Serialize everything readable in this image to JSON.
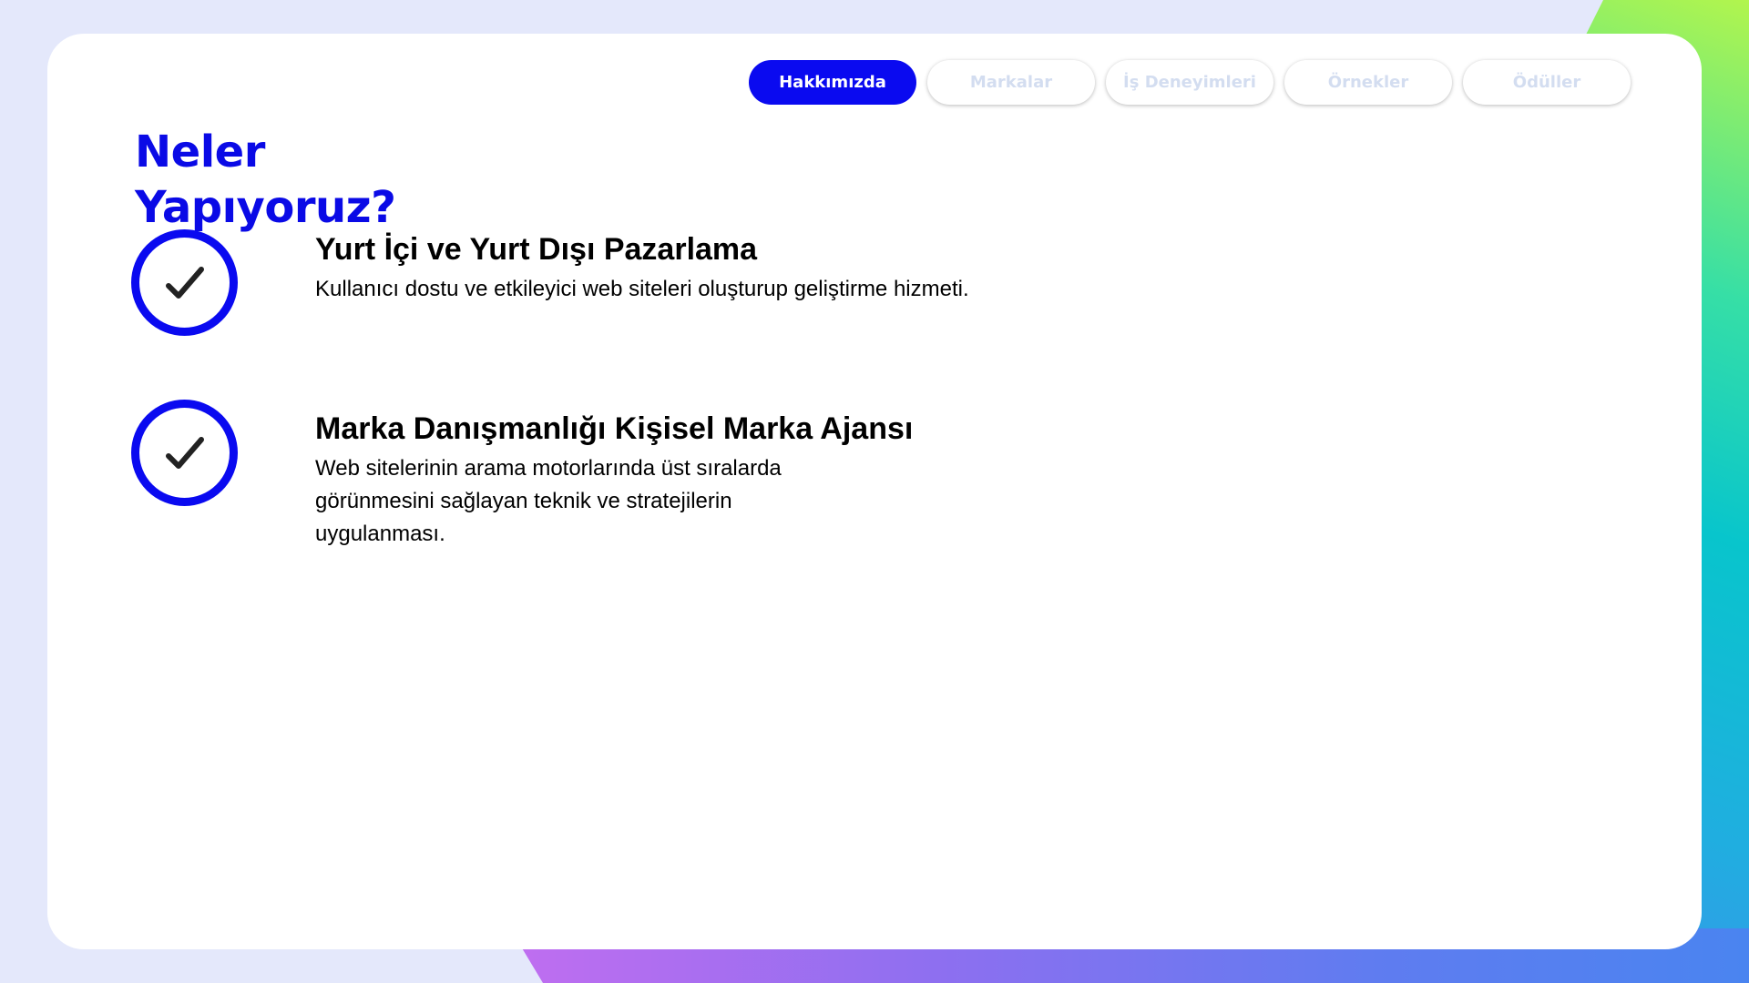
{
  "nav": {
    "tabs": [
      {
        "label": "Hakkımızda",
        "active": true
      },
      {
        "label": "Markalar",
        "active": false
      },
      {
        "label": "İş Deneyimleri",
        "active": false
      },
      {
        "label": "Örnekler",
        "active": false
      },
      {
        "label": "Ödüller",
        "active": false
      }
    ]
  },
  "heading": {
    "line1": "Neler",
    "line2": "Yapıyoruz?"
  },
  "features": [
    {
      "icon": "check-icon",
      "title": "Yurt İçi ve Yurt Dışı Pazarlama",
      "description": "Kullanıcı dostu ve etkileyici web siteleri oluşturup geliştirme hizmeti."
    },
    {
      "icon": "check-icon",
      "title": "Marka Danışmanlığı Kişisel Marka Ajansı",
      "description": "Web sitelerinin arama motorlarında üst sıralarda görünmesini sağlayan teknik ve stratejilerin uygulanması."
    }
  ],
  "colors": {
    "accent": "#0a0af0",
    "heading": "#0a0ae6",
    "inactive_tab_text": "#d3ddf0",
    "background": "#e4e8fb"
  }
}
